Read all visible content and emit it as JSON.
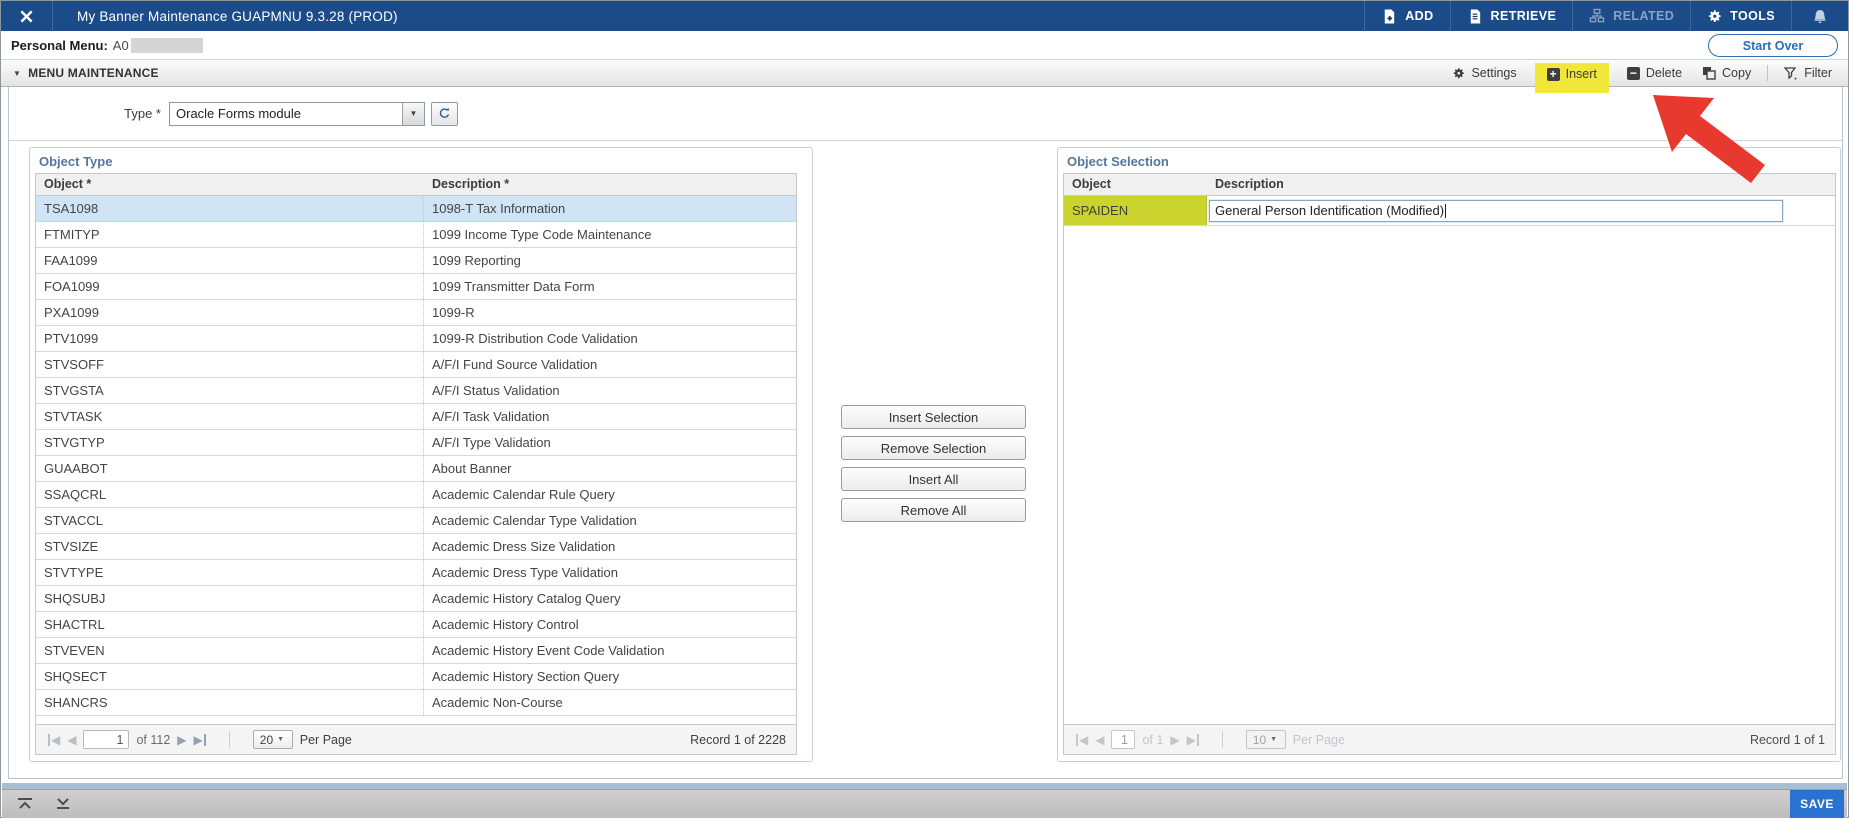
{
  "colors": {
    "navbar_blue": "#1b4c89",
    "highlight_yellow": "#f0e73a",
    "selection_yellow": "#cbd42f",
    "selected_row_blue": "#cfe4f4",
    "arrow_red": "#e8392e",
    "save_blue": "#2a72cf",
    "link_blue": "#2e6cb5",
    "panel_title_blue": "#54779c"
  },
  "titlebar": {
    "title": "My Banner Maintenance GUAPMNU 9.3.28 (PROD)",
    "actions": {
      "add": "ADD",
      "retrieve": "RETRIEVE",
      "related": "RELATED",
      "tools": "TOOLS"
    }
  },
  "personal_menu": {
    "label": "Personal Menu:",
    "value": "A0",
    "start_over_label": "Start Over"
  },
  "section": {
    "title": "MENU MAINTENANCE",
    "toolbar": {
      "settings": "Settings",
      "insert": "Insert",
      "delete": "Delete",
      "copy": "Copy",
      "filter": "Filter"
    }
  },
  "type_row": {
    "label": "Type *",
    "value": "Oracle Forms module"
  },
  "object_type": {
    "title": "Object Type",
    "columns": [
      "Object *",
      "Description *"
    ],
    "selected_index": 0,
    "rows": [
      [
        "TSA1098",
        "1098-T Tax Information"
      ],
      [
        "FTMITYP",
        "1099 Income Type Code Maintenance"
      ],
      [
        "FAA1099",
        "1099 Reporting"
      ],
      [
        "FOA1099",
        "1099 Transmitter Data Form"
      ],
      [
        "PXA1099",
        "1099-R"
      ],
      [
        "PTV1099",
        "1099-R Distribution Code Validation"
      ],
      [
        "STVSOFF",
        "A/F/I Fund Source Validation"
      ],
      [
        "STVGSTA",
        "A/F/I Status Validation"
      ],
      [
        "STVTASK",
        "A/F/I Task Validation"
      ],
      [
        "STVGTYP",
        "A/F/I Type Validation"
      ],
      [
        "GUAABOT",
        "About Banner"
      ],
      [
        "SSAQCRL",
        "Academic Calendar Rule Query"
      ],
      [
        "STVACCL",
        "Academic Calendar Type Validation"
      ],
      [
        "STVSIZE",
        "Academic Dress Size Validation"
      ],
      [
        "STVTYPE",
        "Academic Dress Type Validation"
      ],
      [
        "SHQSUBJ",
        "Academic History Catalog Query"
      ],
      [
        "SHACTRL",
        "Academic History Control"
      ],
      [
        "STVEVEN",
        "Academic History Event Code Validation"
      ],
      [
        "SHQSECT",
        "Academic History Section Query"
      ],
      [
        "SHANCRS",
        "Academic Non-Course"
      ]
    ],
    "pagination": {
      "page": "1",
      "of_label": "of 112",
      "per_page": "20",
      "per_page_label": "Per Page",
      "record": "Record 1 of 2228"
    }
  },
  "transfer_buttons": [
    "Insert Selection",
    "Remove Selection",
    "Insert All",
    "Remove All"
  ],
  "object_selection": {
    "title": "Object Selection",
    "columns": [
      "Object",
      "Description"
    ],
    "row": {
      "object": "SPAIDEN",
      "description": "General Person Identification (Modified)"
    },
    "pagination": {
      "page": "1",
      "of_label": "of 1",
      "per_page": "10",
      "per_page_label": "Per Page",
      "record": "Record 1 of 1"
    }
  },
  "bottombar": {
    "save_label": "SAVE"
  },
  "icons": {
    "close": "x-cross",
    "add": "document-plus",
    "retrieve": "document-lines",
    "related": "org-chart",
    "tools": "gear",
    "notifications": "bell",
    "settings": "gear",
    "insert": "plus-square",
    "delete": "minus-square",
    "copy": "copy-pages",
    "filter": "funnel",
    "type_refresh": "undo-arrow",
    "dropdown": "caret-down",
    "pagination": "first/prev/next/last triangles",
    "bottom_left_1": "collapse-panel",
    "bottom_left_2": "expand-down",
    "annotation": "red-arrow"
  }
}
